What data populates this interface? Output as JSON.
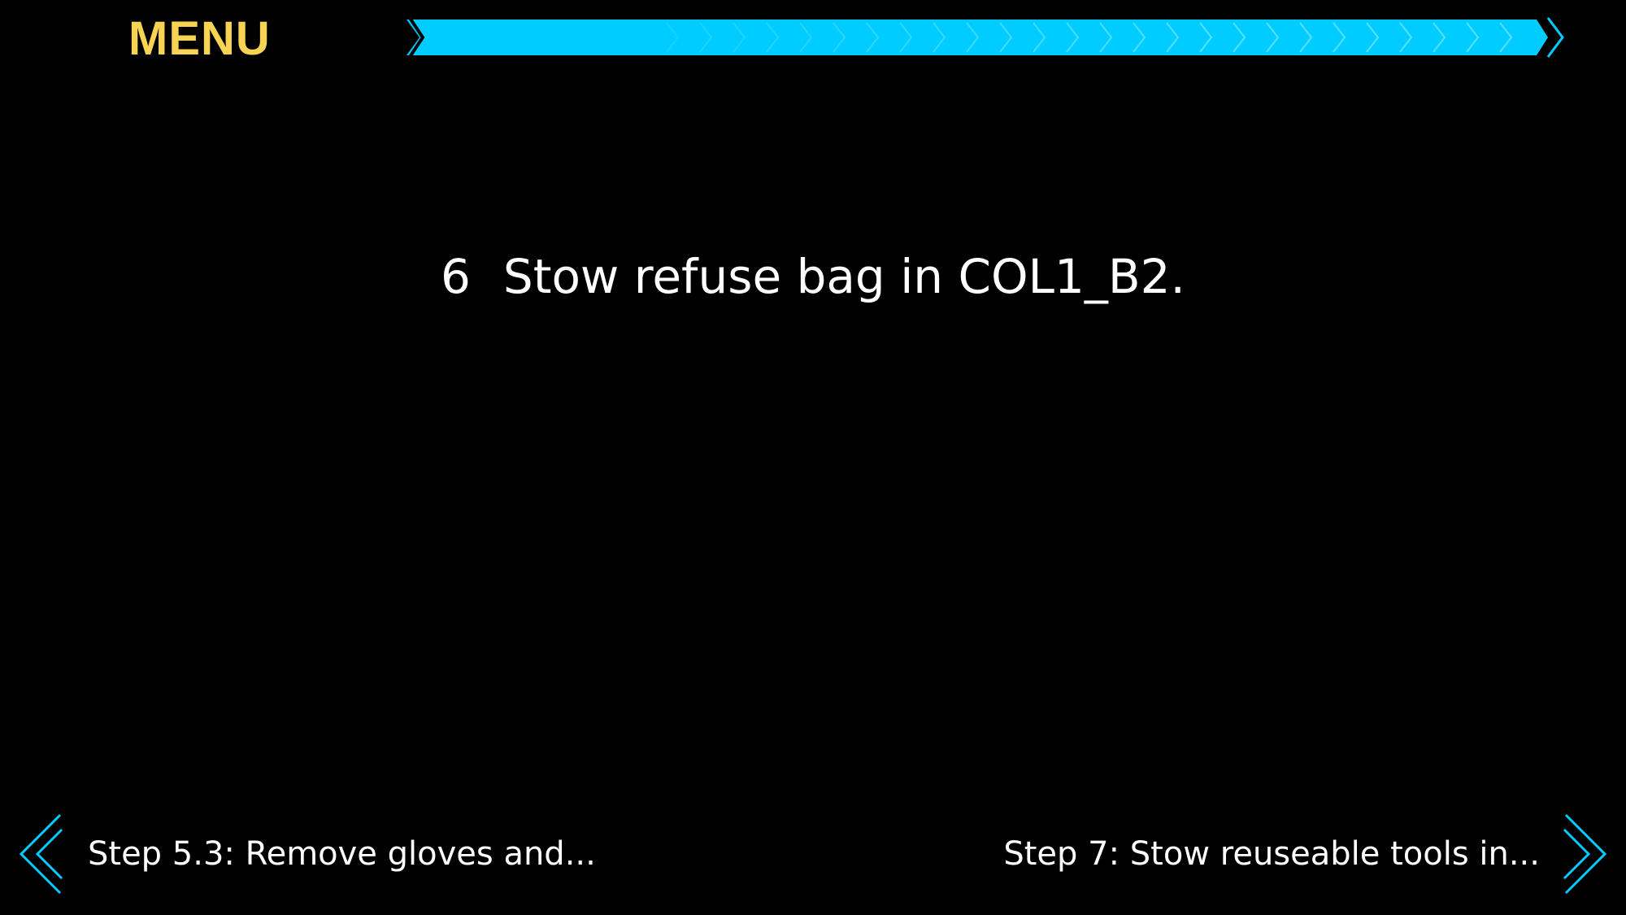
{
  "header": {
    "menu_label": "MENU"
  },
  "progress": {
    "color": "#00ccff",
    "icon": "chevron-right-icon"
  },
  "step": {
    "number": "6",
    "text": "Stow refuse bag in COL1_B2."
  },
  "navigation": {
    "previous": {
      "label": "Step 5.3: Remove gloves and...",
      "icon": "chevron-left-icon"
    },
    "next": {
      "label": "Step 7: Stow reuseable tools in...",
      "icon": "chevron-right-icon"
    }
  },
  "colors": {
    "background": "#000000",
    "menu": "#f7d354",
    "accent": "#00ccff",
    "text": "#ffffff"
  }
}
